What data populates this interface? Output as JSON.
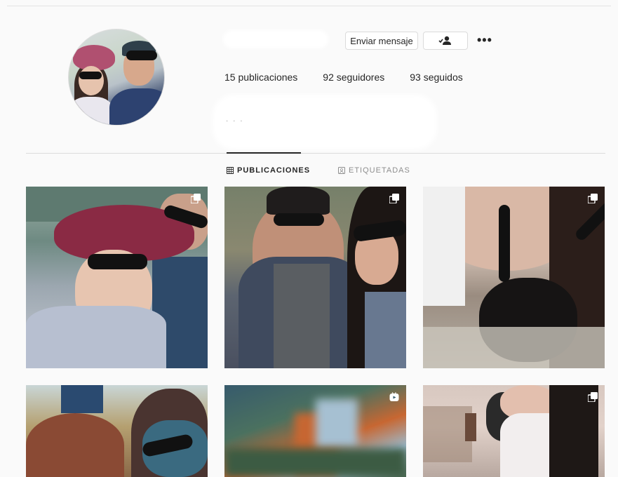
{
  "profile": {
    "send_message_label": "Enviar mensaje",
    "more_label": "•••",
    "stats": [
      {
        "label": "15 publicaciones"
      },
      {
        "label": "92 seguidores"
      },
      {
        "label": "93 seguidos"
      }
    ],
    "bio_dots": "· · ·"
  },
  "tabs": [
    {
      "label": "PUBLICACIONES",
      "active": true
    },
    {
      "label": "ETIQUETADAS",
      "active": false
    }
  ],
  "icons": {
    "follow": "person-check-icon",
    "more": "more-options-icon",
    "grid": "grid-icon",
    "tagged": "tagged-icon",
    "carousel": "multiple-photos-icon",
    "video": "video-icon"
  },
  "colors": {
    "background": "#fafafa",
    "text": "#262626",
    "muted": "#8e8e8e",
    "border": "#dbdbdb"
  }
}
